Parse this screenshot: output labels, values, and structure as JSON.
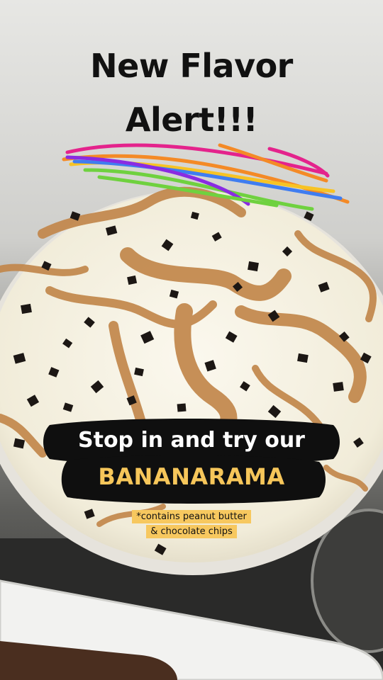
{
  "headline": {
    "line1": "New Flavor",
    "line2": "Alert!!!"
  },
  "promo": {
    "line1": "Stop in and try our",
    "flavor_name": "BANANARAMA"
  },
  "footnote": {
    "line1": "*contains peanut butter",
    "line2": "& chocolate chips"
  },
  "colors": {
    "ice_cream": "#f6f2e4",
    "peanut_butter_swirl": "#c2874b",
    "chocolate_chip": "#1c1714",
    "flavor_name_text": "#f6c65a",
    "footnote_highlight": "#f7c85f",
    "scribble_colors": [
      "#e4238c",
      "#f48a26",
      "#f7c324",
      "#6fd13f",
      "#3f7df0",
      "#8a2be2"
    ]
  }
}
